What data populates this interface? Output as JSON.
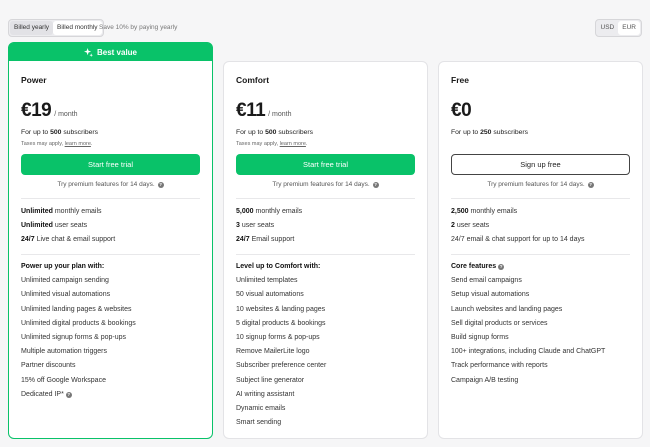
{
  "billing": {
    "yearly": "Billed yearly",
    "monthly": "Billed monthly",
    "save_note": "Save 10% by paying yearly"
  },
  "currency": {
    "usd": "USD",
    "eur": "EUR"
  },
  "info_glyph": "?",
  "plans": [
    {
      "badge": "Best value",
      "name": "Power",
      "price": "€19",
      "period": "/ month",
      "subs_prefix": "For up to",
      "subs_count": "500",
      "subs_suffix": "subscribers",
      "tax": "Taxes may apply,",
      "tax_link": "learn more",
      "tax_end": ".",
      "cta": "Start free trial",
      "trial_note": "Try premium features for 14 days.",
      "basics": [
        {
          "b": "Unlimited",
          "t": "monthly emails"
        },
        {
          "b": "Unlimited",
          "t": "user seats"
        },
        {
          "b": "24/7",
          "t": "Live chat & email support"
        }
      ],
      "features_title": "Power up your plan with:",
      "features": [
        "Unlimited campaign sending",
        "Unlimited visual automations",
        "Unlimited landing pages & websites",
        "Unlimited digital products & bookings",
        "Unlimited signup forms & pop-ups",
        "Multiple automation triggers",
        "Partner discounts",
        "15% off Google Workspace",
        "Dedicated IP*"
      ]
    },
    {
      "name": "Comfort",
      "price": "€11",
      "period": "/ month",
      "subs_prefix": "For up to",
      "subs_count": "500",
      "subs_suffix": "subscribers",
      "tax": "Taxes may apply,",
      "tax_link": "learn more",
      "tax_end": ".",
      "cta": "Start free trial",
      "trial_note": "Try premium features for 14 days.",
      "basics": [
        {
          "b": "5,000",
          "t": "monthly emails"
        },
        {
          "b": "3",
          "t": "user seats"
        },
        {
          "b": "24/7",
          "t": "Email support"
        }
      ],
      "features_title": "Level up to Comfort with:",
      "features": [
        "Unlimited templates",
        "50 visual automations",
        "10 websites & landing pages",
        "5 digital products & bookings",
        "10 signup forms & pop-ups",
        "Remove MailerLite logo",
        "Subscriber preference center",
        "Subject line generator",
        "AI writing assistant",
        "Dynamic emails",
        "Smart sending"
      ]
    },
    {
      "name": "Free",
      "price": "€0",
      "subs_prefix": "For up to",
      "subs_count": "250",
      "subs_suffix": "subscribers",
      "cta": "Sign up free",
      "trial_note": "Try premium features for 14 days.",
      "basics": [
        {
          "b": "2,500",
          "t": "monthly emails"
        },
        {
          "b": "2",
          "t": "user seats"
        },
        {
          "b": "",
          "t": "24/7 email & chat support for up to 14 days"
        }
      ],
      "features_title": "Core features",
      "features": [
        "Send email campaigns",
        "Setup visual automations",
        "Launch websites and landing pages",
        "Sell digital products or services",
        "Build signup forms",
        "100+ integrations, including Claude and ChatGPT",
        "Track performance with reports",
        "Campaign A/B testing"
      ]
    }
  ],
  "colors": {
    "accent": "#09c269"
  }
}
